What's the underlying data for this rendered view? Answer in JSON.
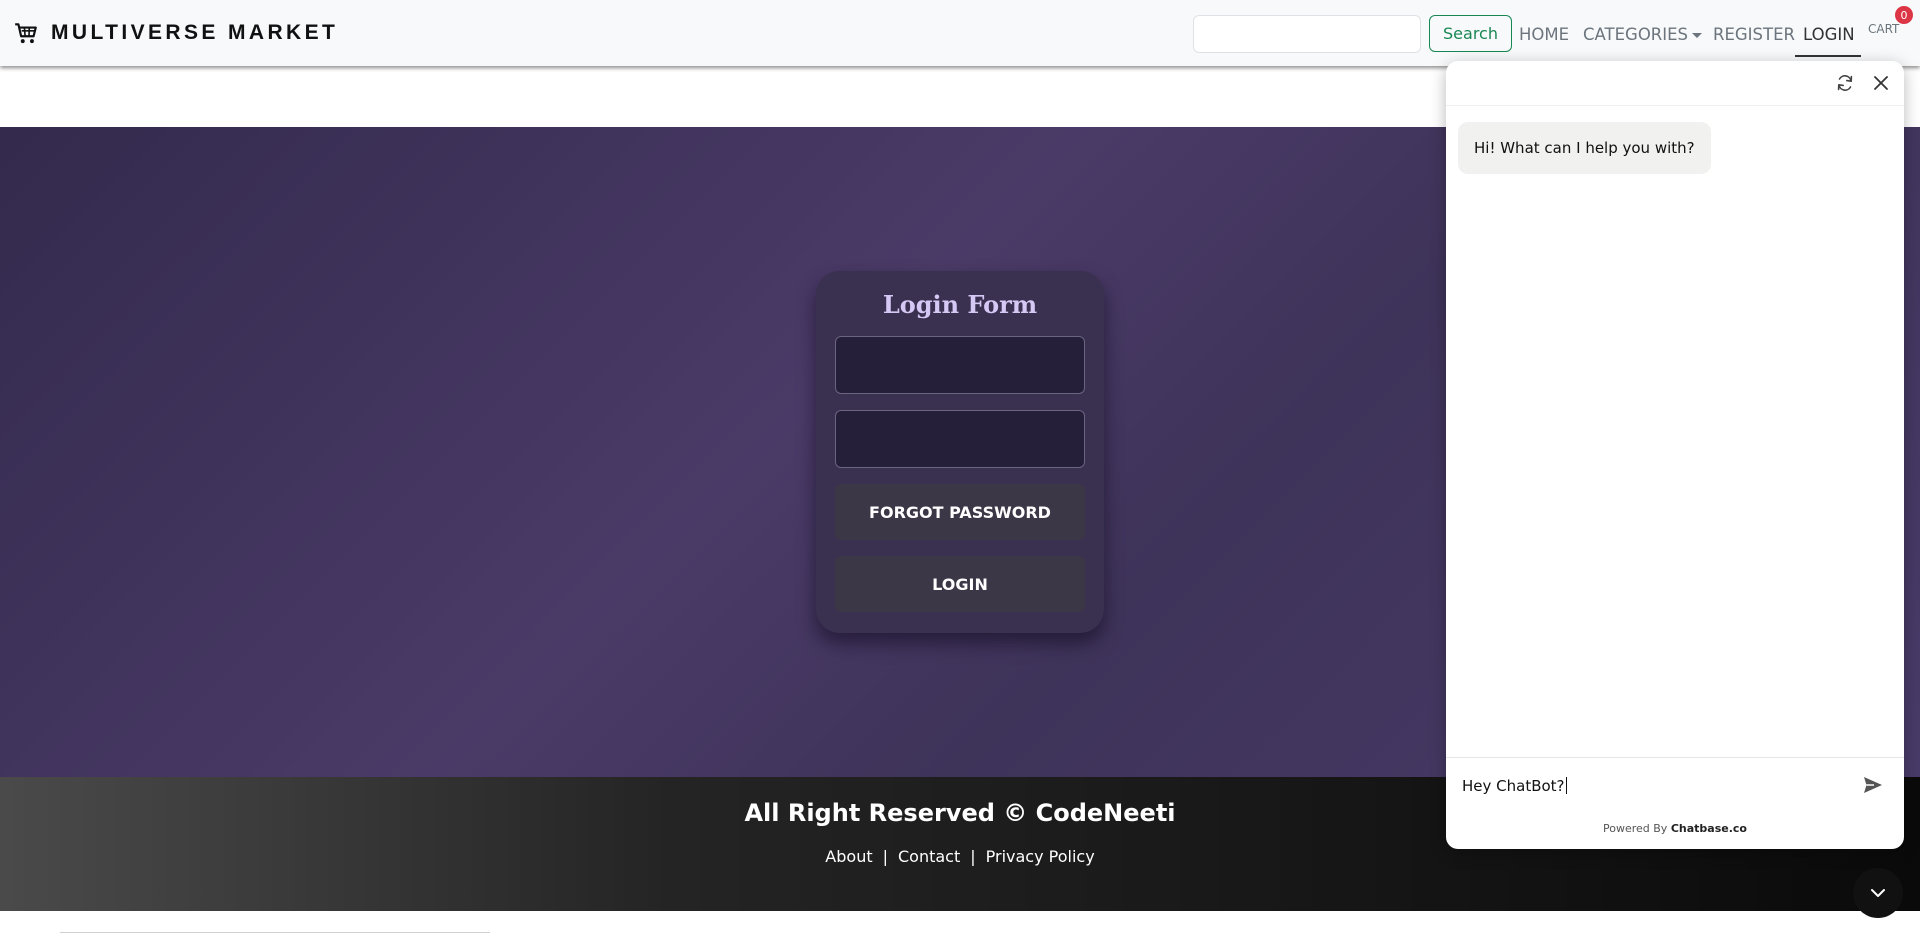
{
  "navbar": {
    "brand": "MULTIVERSE MARKET",
    "brand_icon": "cart-icon",
    "search_placeholder": "",
    "search_button": "Search",
    "links": {
      "home": "HOME",
      "categories": "CATEGORIES",
      "register": "REGISTER",
      "login": "LOGIN",
      "cart": "CART"
    },
    "cart_count": "0",
    "active_link": "LOGIN"
  },
  "login_form": {
    "title": "Login Form",
    "username_value": "",
    "password_value": "",
    "forgot_button": "FORGOT PASSWORD",
    "login_button": "LOGIN"
  },
  "footer": {
    "title": "All Right Reserved © CodeNeeti",
    "links": [
      "About",
      "Contact",
      "Privacy Policy"
    ],
    "separator": "|"
  },
  "chatbot": {
    "refresh_icon": "refresh-icon",
    "close_icon": "close-icon",
    "greeting": "Hi! What can I help you with?",
    "input_value": "Hey ChatBot?",
    "send_icon": "send-icon",
    "powered_prefix": "Powered By",
    "powered_brand": "Chatbase.co",
    "toggle_icon": "chevron-down-icon"
  },
  "colors": {
    "accent_green": "#198754",
    "badge_red": "#dc3545",
    "hero_purple": "#4a3a67",
    "card_bg": "#3a304f",
    "title_lavender": "#d6c8f5"
  }
}
